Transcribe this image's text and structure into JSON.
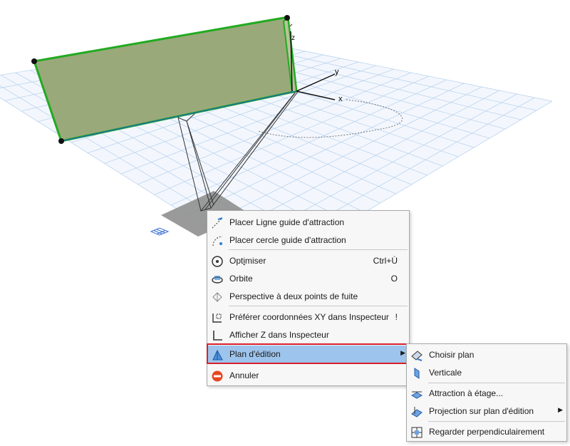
{
  "viewport": {
    "axis_labels": {
      "x": "x",
      "y": "y",
      "z": "z"
    },
    "colors": {
      "grid": "#bcd3ef",
      "plane_fill": "#9aa97a",
      "plane_edge": "#22aa22",
      "shadow": "#8f8f8f"
    }
  },
  "context_menu": {
    "items": [
      {
        "label": "Placer Ligne guide d'attraction",
        "icon": "guide-line-icon",
        "shortcut": ""
      },
      {
        "label": "Placer cercle guide d'attraction",
        "icon": "guide-circle-icon",
        "shortcut": ""
      },
      {
        "label_parts": [
          "Opt",
          "i",
          "miser"
        ],
        "icon": "optimize-zoom-icon",
        "shortcut": "Ctrl+Ù"
      },
      {
        "label": "Orbite",
        "icon": "orbit-icon",
        "shortcut": "O"
      },
      {
        "label": "Perspective à deux points de fuite",
        "icon": "two-point-perspective-icon",
        "shortcut": ""
      },
      {
        "label": "Préférer coordonnées XY dans Inspecteur",
        "icon": "xy-coordinates-icon",
        "shortcut": "!"
      },
      {
        "label": "Afficher Z dans Inspecteur",
        "icon": "z-axis-icon",
        "shortcut": ""
      },
      {
        "label": "Plan d'édition",
        "icon": "editing-plane-icon",
        "shortcut": "",
        "highlighted": true,
        "submenu": true
      },
      {
        "label": "Annuler",
        "icon": "cancel-icon",
        "shortcut": ""
      }
    ],
    "highlight_color": "#9dc4ec",
    "annotation_color": "#d9202a"
  },
  "submenu": {
    "items": [
      {
        "label": "Choisir plan",
        "icon": "choose-plane-icon"
      },
      {
        "label": "Verticale",
        "icon": "vertical-plane-icon"
      },
      {
        "label": "Attraction à étage...",
        "icon": "story-snap-icon"
      },
      {
        "label": "Projection sur plan d'édition",
        "icon": "projection-icon",
        "submenu": true
      },
      {
        "label": "Regarder perpendiculairement",
        "icon": "look-perpendicular-icon"
      }
    ]
  }
}
